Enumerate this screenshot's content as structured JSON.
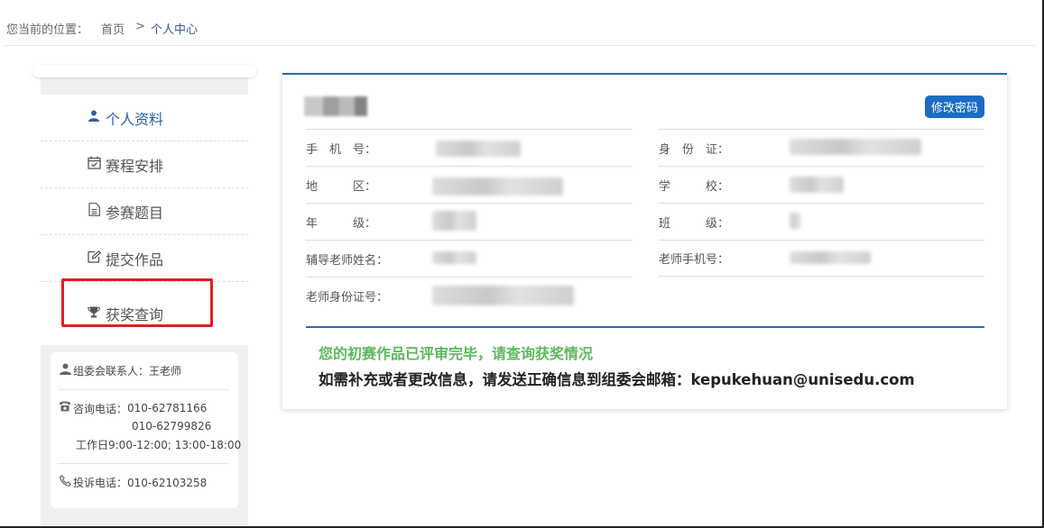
{
  "breadcrumb": {
    "prefix": "您当前的位置：",
    "home": "首页",
    "separator": ">",
    "current": "个人中心"
  },
  "sidebar": {
    "items": [
      {
        "label": "个人资料",
        "icon": "user-icon",
        "active": true
      },
      {
        "label": "赛程安排",
        "icon": "calendar-check-icon",
        "active": false
      },
      {
        "label": "参赛题目",
        "icon": "file-text-icon",
        "active": false
      },
      {
        "label": "提交作品",
        "icon": "edit-icon",
        "active": false
      },
      {
        "label": "获奖查询",
        "icon": "trophy-icon",
        "active": false
      }
    ],
    "contact": {
      "organizer": "组委会联系人：王老师",
      "phone_label": "咨询电话：",
      "phone1": "010-62781166",
      "phone2": "010-62799826",
      "hours": "工作日9:00-12:00; 13:00-18:00",
      "complaint": "投诉电话：010-62103258"
    }
  },
  "profile": {
    "change_password_label": "修改密码",
    "fields": {
      "phone": "手　机　号：",
      "id_card": "身　份　证：",
      "region": "地　　　区：",
      "school": "学　　　校：",
      "grade": "年　　　级：",
      "class": "班　　　级：",
      "tutor_name": "辅导老师姓名：",
      "teacher_phone": "老师手机号：",
      "teacher_id": "老师身份证号："
    },
    "notice": "您的初赛作品已评审完毕，请查询获奖情况",
    "info": "如需补充或者更改信息，请发送正确信息到组委会邮箱：kepukehuan@unisedu.com"
  },
  "colors": {
    "accent": "#1c6cc4",
    "highlight": "#e51c1c",
    "notice_green": "#5cb85c"
  }
}
